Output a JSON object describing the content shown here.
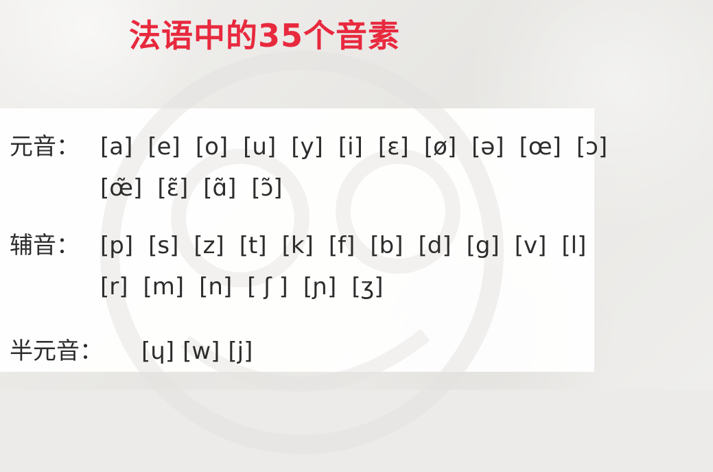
{
  "title": "法语中的35个音素",
  "vowels": {
    "label": "元音：",
    "line1": [
      "[a]",
      "[e]",
      "[o]",
      "[u]",
      "[y]",
      "[i]",
      "[ɛ]",
      "[ø]",
      "[ə]",
      "[œ]",
      "[ɔ]"
    ],
    "line2": [
      "[œ̃]",
      "[ɛ̃]",
      "[ɑ̃]",
      "[ɔ̃]"
    ]
  },
  "consonants": {
    "label": "辅音：",
    "line1": [
      "[p]",
      "[s]",
      "[z]",
      "[t]",
      "[k]",
      "[f]",
      "[b]",
      "[d]",
      "[g]",
      "[v]",
      "[l]"
    ],
    "line2": [
      "[r]",
      "[m]",
      "[n]",
      "[ ʃ ]",
      "[ɲ]",
      "[ʒ]"
    ]
  },
  "semivowels": {
    "label": "半元音：",
    "line1": [
      "[ɥ]",
      "[w]",
      "[j]"
    ]
  },
  "colors": {
    "title": "#e8293e",
    "text": "#2c2c2c"
  }
}
